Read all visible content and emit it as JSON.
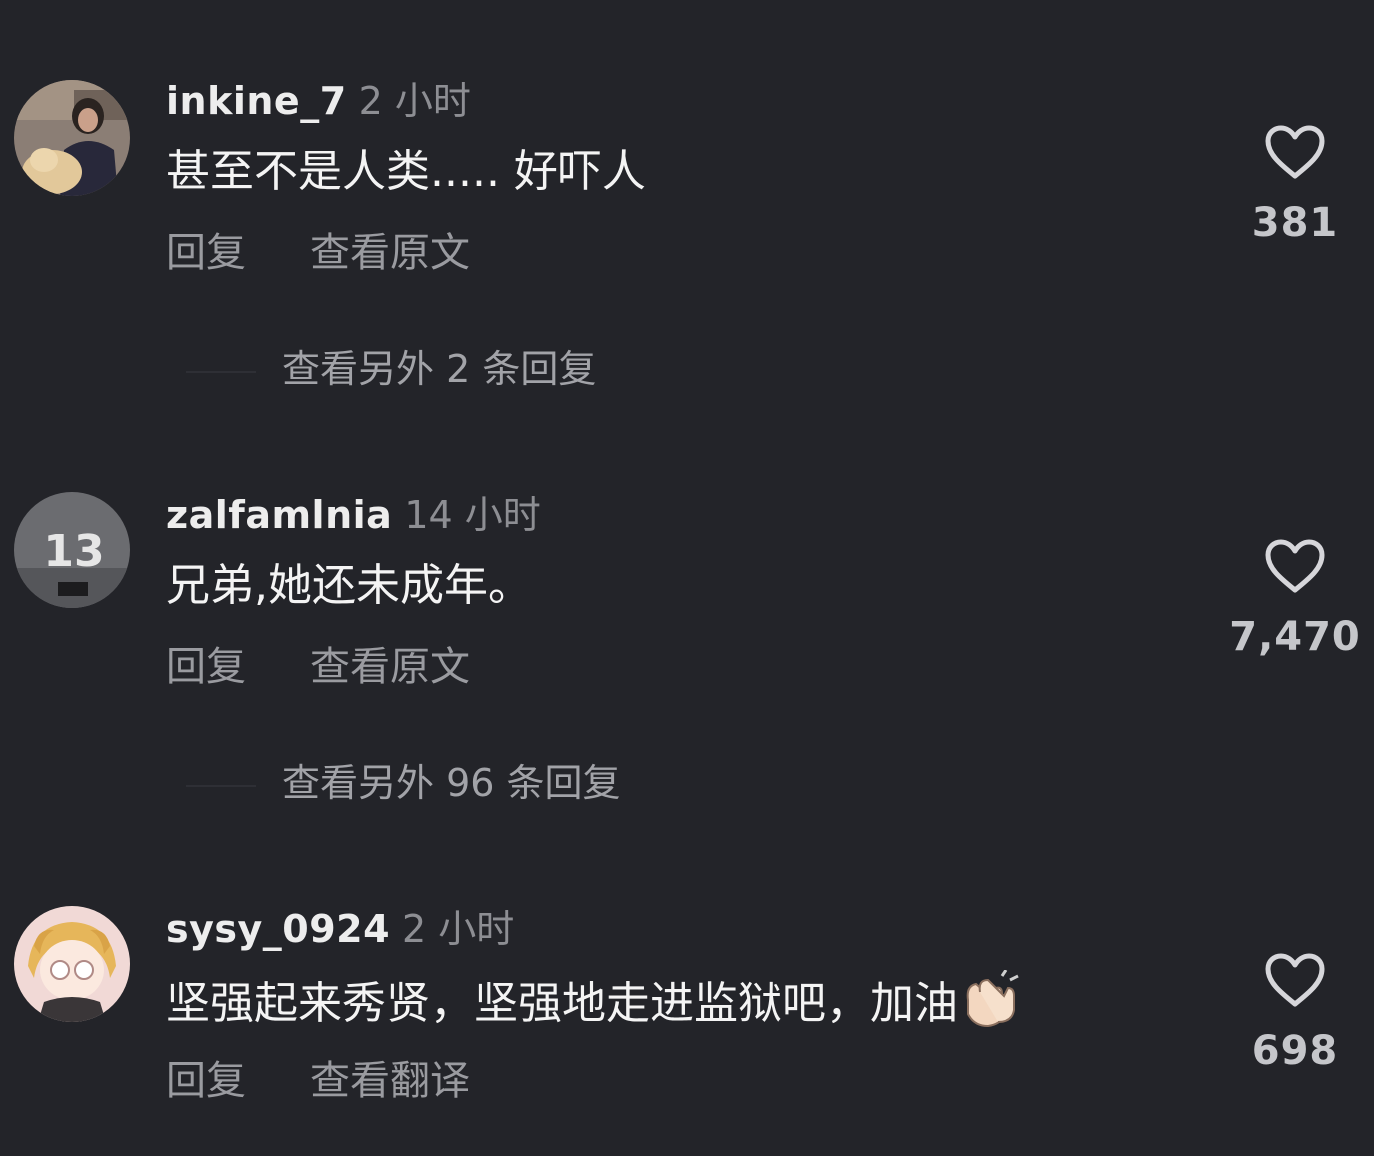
{
  "comments": [
    {
      "username": "inkine_7",
      "time": "2 小时",
      "text": "甚至不是人类..... 好吓人",
      "reply_label": "回复",
      "secondary_label": "查看原文",
      "likes": "381",
      "more_replies": "查看另外 2 条回复"
    },
    {
      "username": "zalfamlnia",
      "time": "14 小时",
      "text": "兄弟,她还未成年。",
      "reply_label": "回复",
      "secondary_label": "查看原文",
      "likes": "7,470",
      "more_replies": "查看另外 96 条回复",
      "avatar_badge": "13"
    },
    {
      "username": "sysy_0924",
      "time": "2 小时",
      "text": "坚强起来秀贤，坚强地走进监狱吧，加油",
      "reply_label": "回复",
      "secondary_label": "查看翻译",
      "likes": "698"
    }
  ],
  "icons": {
    "like": "heart-outline-icon",
    "emoji": "clapping-hands-emoji"
  },
  "colors": {
    "background": "#232429",
    "primary_text": "#f4f4f4",
    "secondary_text": "#9a9ba0"
  }
}
